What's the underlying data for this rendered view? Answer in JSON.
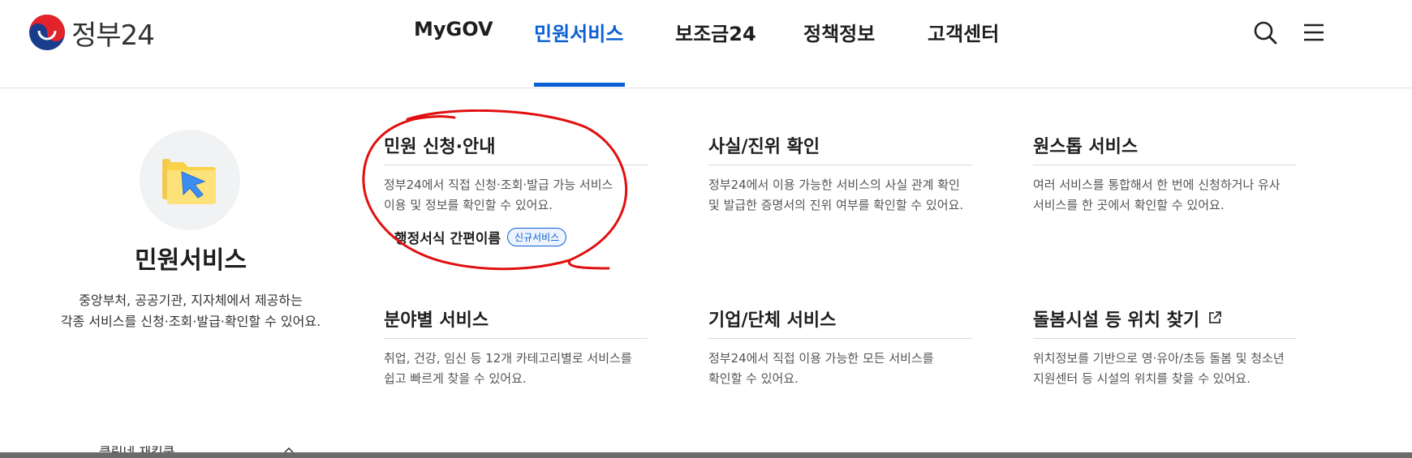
{
  "logo": {
    "text": "정부24"
  },
  "nav": {
    "items": [
      {
        "label": "MyGOV"
      },
      {
        "label": "민원서비스"
      },
      {
        "label": "보조금24"
      },
      {
        "label": "정책정보"
      },
      {
        "label": "고객센터"
      }
    ],
    "active_index": 1
  },
  "utility": {
    "search_icon": "search-icon",
    "menu_icon": "hamburger-menu-icon"
  },
  "intro": {
    "title": "민원서비스",
    "desc_line1": "중앙부처, 공공기관, 지자체에서 제공하는",
    "desc_line2": "각종 서비스를 신청·조회·발급·확인할 수 있어요.",
    "icon": "folder-cursor-icon"
  },
  "cards": [
    {
      "title": "민원 신청·안내",
      "desc_line1": "정부24에서 직접 신청·조회·발급 가능 서비스",
      "desc_line2": "이용 및 정보를 확인할 수 있어요.",
      "sub_link": {
        "label": "행정서식 간편이름",
        "badge": "신규서비스"
      }
    },
    {
      "title": "사실/진위 확인",
      "desc_line1": "정부24에서 이용 가능한 서비스의 사실 관계 확인",
      "desc_line2": "및 발급한 증명서의 진위 여부를 확인할 수 있어요."
    },
    {
      "title": "원스톱 서비스",
      "desc_line1": "여러 서비스를 통합해서 한 번에 신청하거나 유사",
      "desc_line2": "서비스를 한 곳에서 확인할 수 있어요."
    },
    {
      "title": "분야별 서비스",
      "desc_line1": "취업, 건강, 임신 등 12개 카테고리별로 서비스를",
      "desc_line2": "쉽고 빠르게 찾을 수 있어요."
    },
    {
      "title": "기업/단체 서비스",
      "desc_line1": "정부24에서 직접 이용 가능한 모든 서비스를",
      "desc_line2": "확인할 수 있어요."
    },
    {
      "title": "돌봄시설 등 위치 찾기",
      "desc_line1": "위치정보를 기반으로 영·유아/초등 돌봄 및 청소년",
      "desc_line2": "지원센터 등 시설의 위치를 찾을 수 있어요.",
      "external_icon": "external-link-icon"
    }
  ],
  "bottom_peek": {
    "text": "클릭네 재킹쿡"
  },
  "colors": {
    "accent": "#0b5fd4",
    "annotation": "#e01010",
    "text": "#1e1e1e"
  }
}
